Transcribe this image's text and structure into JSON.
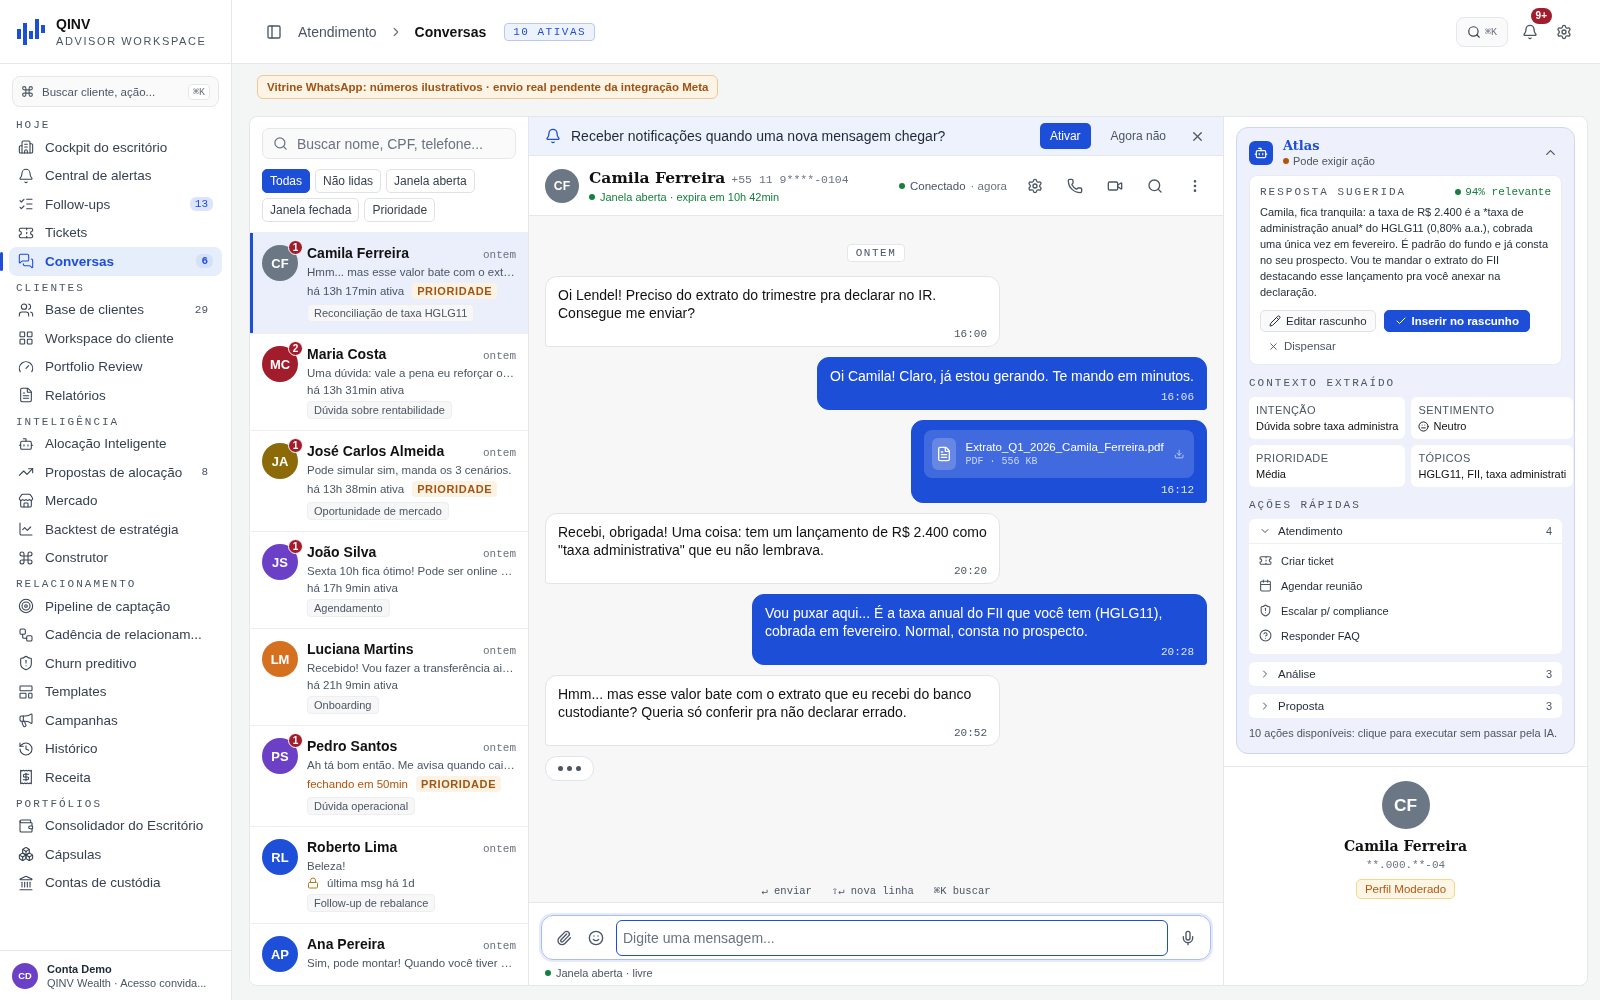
{
  "brand": {
    "name": "QINV",
    "subtitle": "ADVISOR WORKSPACE"
  },
  "sidebar": {
    "search": {
      "placeholder": "Buscar cliente, ação...",
      "shortcut": "⌘K"
    },
    "sections": [
      {
        "title": "HOJE",
        "items": [
          {
            "label": "Cockpit do escritório",
            "selected": false
          },
          {
            "label": "Central de alertas",
            "selected": false
          },
          {
            "label": "Follow-ups",
            "count": "13",
            "selected": false
          },
          {
            "label": "Tickets",
            "selected": false
          },
          {
            "label": "Conversas",
            "count": "6",
            "selected": true
          }
        ]
      },
      {
        "title": "CLIENTES",
        "items": [
          {
            "label": "Base de clientes",
            "count": "29",
            "selected": false
          },
          {
            "label": "Workspace do cliente",
            "selected": false
          },
          {
            "label": "Portfolio Review",
            "selected": false
          },
          {
            "label": "Relatórios",
            "selected": false
          }
        ]
      },
      {
        "title": "INTELIGÊNCIA",
        "items": [
          {
            "label": "Alocação Inteligente",
            "selected": false
          },
          {
            "label": "Propostas de alocação",
            "count": "8",
            "selected": false
          },
          {
            "label": "Mercado",
            "selected": false
          },
          {
            "label": "Backtest de estratégia",
            "selected": false
          },
          {
            "label": "Construtor",
            "selected": false
          }
        ]
      },
      {
        "title": "RELACIONAMENTO",
        "items": [
          {
            "label": "Pipeline de captação",
            "selected": false
          },
          {
            "label": "Cadência de relacionam...",
            "selected": false
          },
          {
            "label": "Churn preditivo",
            "selected": false
          },
          {
            "label": "Templates",
            "selected": false
          },
          {
            "label": "Campanhas",
            "selected": false
          },
          {
            "label": "Histórico",
            "selected": false
          },
          {
            "label": "Receita",
            "selected": false
          }
        ]
      },
      {
        "title": "PORTFÓLIOS",
        "items": [
          {
            "label": "Consolidador do Escritório",
            "selected": false
          },
          {
            "label": "Cápsulas",
            "selected": false
          },
          {
            "label": "Contas de custódia",
            "selected": false
          }
        ]
      }
    ],
    "account": {
      "initials": "CD",
      "name": "Conta Demo",
      "detail": "QINV Wealth · Acesso convida..."
    }
  },
  "topbar": {
    "breadcrumb": "Atendimento",
    "title": "Conversas",
    "badge": "10 ATIVAS",
    "search_shortcut": "⌘K",
    "notification_count": "9+"
  },
  "notice": "Vitrine WhatsApp: números ilustrativos · envio real pendente da integração Meta",
  "conversation_list": {
    "search": {
      "placeholder": "Buscar nome, CPF, telefone..."
    },
    "filters": [
      {
        "label": "Todas",
        "selected": true
      },
      {
        "label": "Não lidas",
        "selected": false
      },
      {
        "label": "Janela aberta",
        "selected": false
      },
      {
        "label": "Janela fechada",
        "selected": false
      },
      {
        "label": "Prioridade",
        "selected": false
      }
    ],
    "conversations": [
      {
        "initials": "CF",
        "color": "#6b7784",
        "unread": "1",
        "name": "Camila Ferreira",
        "time": "ontem",
        "preview": "Hmm... mas esse valor bate com o ext…",
        "status": {
          "text": "há 13h 17min ativa",
          "kind": "active"
        },
        "priority": "PRIORIDADE",
        "tag": "Reconciliação de taxa HGLG11",
        "selected": true
      },
      {
        "initials": "MC",
        "color": "#a11d2b",
        "unread": "2",
        "name": "Maria Costa",
        "time": "ontem",
        "preview": "Uma dúvida: vale a pena eu reforçar o…",
        "status": {
          "text": "há 13h 31min ativa",
          "kind": "active"
        },
        "tag": "Dúvida sobre rentabilidade",
        "selected": false
      },
      {
        "initials": "JA",
        "color": "#8c6a08",
        "unread": "1",
        "name": "José Carlos Almeida",
        "time": "ontem",
        "preview": "Pode simular sim, manda os 3 cenários.",
        "status": {
          "text": "há 13h 38min ativa",
          "kind": "active"
        },
        "priority": "PRIORIDADE",
        "tag": "Oportunidade de mercado",
        "selected": false
      },
      {
        "initials": "JS",
        "color": "#6b3fc6",
        "unread": "1",
        "name": "João Silva",
        "time": "ontem",
        "preview": "Sexta 10h fica ótimo! Pode ser online …",
        "status": {
          "text": "há 17h 9min ativa",
          "kind": "active"
        },
        "tag": "Agendamento",
        "selected": false
      },
      {
        "initials": "LM",
        "color": "#d5701f",
        "name": "Luciana Martins",
        "time": "ontem",
        "preview": "Recebido! Vou fazer a transferência ai…",
        "status": {
          "text": "há 21h 9min ativa",
          "kind": "active"
        },
        "tag": "Onboarding",
        "selected": false
      },
      {
        "initials": "PS",
        "color": "#6b3fc6",
        "unread": "1",
        "name": "Pedro Santos",
        "time": "ontem",
        "preview": "Ah tá bom então. Me avisa quando cai…",
        "status": {
          "text": "fechando em 50min",
          "kind": "closing"
        },
        "priority": "PRIORIDADE",
        "tag": "Dúvida operacional",
        "selected": false
      },
      {
        "initials": "RL",
        "color": "#1d4fd8",
        "name": "Roberto Lima",
        "time": "ontem",
        "preview": "Beleza!",
        "status": {
          "text": "última msg há 1d",
          "kind": "locked"
        },
        "tag": "Follow-up de rebalance",
        "selected": false
      },
      {
        "initials": "AP",
        "color": "#1d4fd8",
        "name": "Ana Pereira",
        "time": "ontem",
        "preview": "Sim, pode montar! Quando você tiver …",
        "selected": false
      }
    ]
  },
  "chat": {
    "prompt": {
      "text": "Receber notificações quando uma nova mensagem chegar?",
      "accept": "Ativar",
      "dismiss": "Agora não"
    },
    "contact": {
      "initials": "CF",
      "name": "Camila Ferreira",
      "phone": "+55 11 9****-0104",
      "window": "Janela aberta · expira em 10h 42min",
      "presence": "Conectado",
      "presence_time": "· agora"
    },
    "day_label": "ONTEM",
    "messages": [
      {
        "kind": "incoming",
        "text": "Oi Lendel! Preciso do extrato do trimestre pra declarar no IR. Consegue me enviar?",
        "time": "16:00"
      },
      {
        "kind": "outgoing",
        "text": "Oi Camila! Claro, já estou gerando. Te mando em minutos.",
        "time": "16:06"
      },
      {
        "kind": "file",
        "file_name": "Extrato_Q1_2026_Camila_Ferreira.pdf",
        "file_meta": "PDF · 556 KB",
        "time": "16:12"
      },
      {
        "kind": "incoming",
        "text": "Recebi, obrigada! Uma coisa: tem um lançamento de R$ 2.400 como \"taxa administrativa\" que eu não lembrava.",
        "time": "20:20"
      },
      {
        "kind": "outgoing",
        "text": "Vou puxar aqui... É a taxa anual do FII que você tem (HGLG11), cobrada em fevereiro. Normal, consta no prospecto.",
        "time": "20:28"
      },
      {
        "kind": "incoming",
        "text": "Hmm... mas esse valor bate com o extrato que eu recebi do banco custodiante? Queria só conferir pra não declarar errado.",
        "time": "20:52"
      }
    ],
    "typing": true,
    "shortcuts": [
      "↵ enviar",
      "⇧↵ nova linha",
      "⌘K buscar"
    ],
    "composer": {
      "placeholder": "Digite uma mensagem..."
    },
    "composer_status": "Janela aberta · livre"
  },
  "atlas": {
    "name": "Atlas",
    "status": "Pode exigir ação",
    "expanded": true,
    "suggestion": {
      "title": "RESPOSTA SUGERIDA",
      "relevance": "94% relevante",
      "text": "Camila, fica tranquila: a taxa de R$ 2.400 é a *taxa de administração anual* do HGLG11 (0,80% a.a.), cobrada uma única vez em fevereiro. É padrão do fundo e já consta no seu prospecto. Vou te mandar o extrato do FII destacando esse lançamento pra você anexar na declaração.",
      "edit": "Editar rascunho",
      "insert": "Inserir no rascunho",
      "dismiss": "Dispensar"
    },
    "context_title": "CONTEXTO EXTRAÍDO",
    "context": [
      {
        "label": "INTENÇÃO",
        "value": "Dúvida sobre taxa administra"
      },
      {
        "label": "SENTIMENTO",
        "value": "Neutro",
        "kind": "sentiment"
      },
      {
        "label": "PRIORIDADE",
        "value": "Média"
      },
      {
        "label": "TÓPICOS",
        "value": "HGLG11, FII, taxa administrati"
      }
    ],
    "actions_title": "AÇÕES RÁPIDAS",
    "action_groups": [
      {
        "label": "Atendimento",
        "count": "4",
        "expanded": true,
        "items": [
          "Criar ticket",
          "Agendar reunião",
          "Escalar p/ compliance",
          "Responder FAQ"
        ]
      },
      {
        "label": "Análise",
        "count": "3",
        "expanded": false
      },
      {
        "label": "Proposta",
        "count": "3",
        "expanded": false
      }
    ],
    "footer": "10 ações disponíveis: clique para executar sem passar pela IA."
  },
  "profile": {
    "initials": "CF",
    "name": "Camila Ferreira",
    "document": "**.000.**-04",
    "tag": "Perfil Moderado"
  }
}
